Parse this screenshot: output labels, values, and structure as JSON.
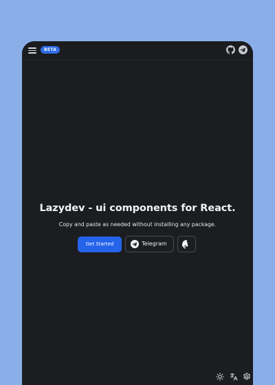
{
  "topbar": {
    "badge": "BETA",
    "icons": [
      "menu-icon",
      "github-icon",
      "telegram-icon"
    ]
  },
  "hero": {
    "title": "Lazydev - ui components for React.",
    "subtitle": "Copy and paste as needed without installing any package.",
    "primary_button": "Get Started",
    "telegram_button": "Telegram",
    "github_button_icon": "github-icon"
  },
  "footer_icons": [
    "sun-icon",
    "translate-icon",
    "gear-icon"
  ],
  "colors": {
    "page_background": "#8aafe8",
    "app_background": "#1c1d21",
    "accent": "#2563eb",
    "text": "#f2f3f5",
    "outline": "#4b4d55"
  }
}
